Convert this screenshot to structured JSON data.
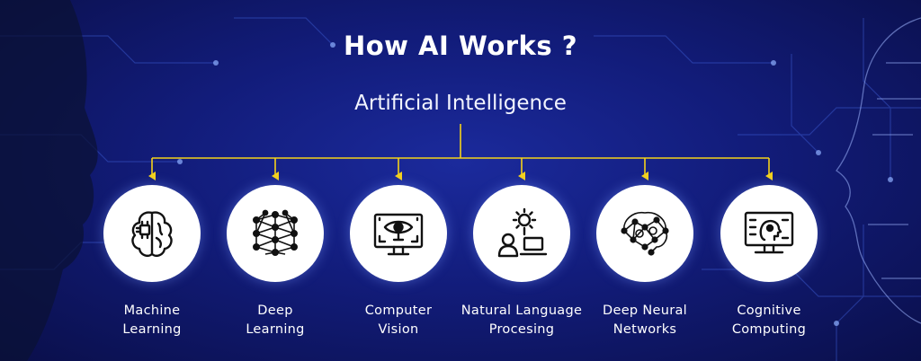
{
  "header": {
    "title": "How AI Works ?",
    "root_label": "Artificial Intelligence"
  },
  "colors": {
    "connector": "#f5d21a",
    "background": "#121c7a",
    "node_fill": "#ffffff",
    "icon_stroke": "#111111"
  },
  "nodes": [
    {
      "icon": "brain-chip-icon",
      "line1": "Machine",
      "line2": "Learning"
    },
    {
      "icon": "network-mesh-icon",
      "line1": "Deep",
      "line2": "Learning"
    },
    {
      "icon": "monitor-eye-icon",
      "line1": "Computer",
      "line2": "Vision"
    },
    {
      "icon": "gear-person-laptop-icon",
      "line1": "Natural Language",
      "line2": "Procesing"
    },
    {
      "icon": "neural-brain-gears-icon",
      "line1": "Deep Neural",
      "line2": "Networks"
    },
    {
      "icon": "monitor-head-icon",
      "line1": "Cognitive",
      "line2": "Computing"
    }
  ]
}
